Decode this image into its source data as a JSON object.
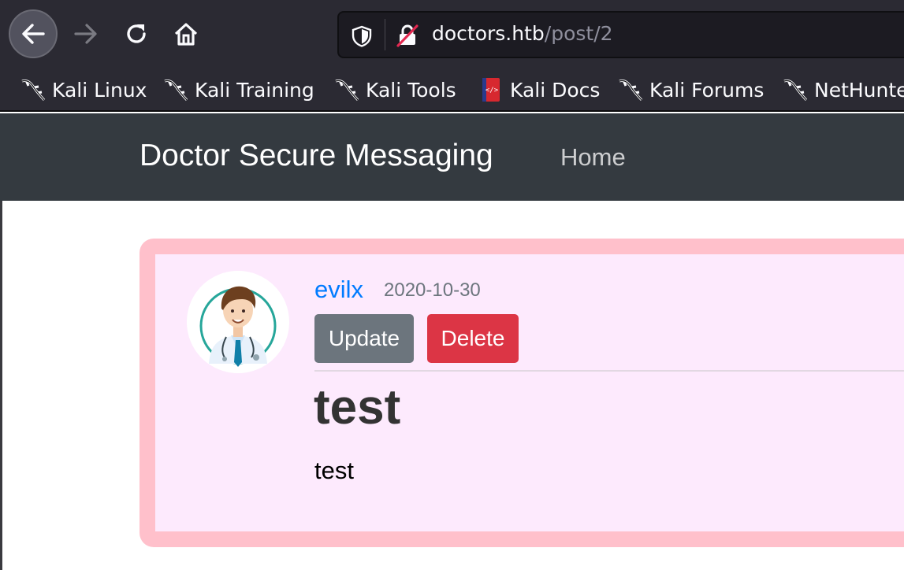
{
  "browser": {
    "url_host": "doctors.htb",
    "url_path": "/post/2",
    "bookmarks": [
      {
        "label": "Kali Linux",
        "icon": "kali-dragon-icon"
      },
      {
        "label": "Kali Training",
        "icon": "kali-dragon-icon"
      },
      {
        "label": "Kali Tools",
        "icon": "kali-dragon-icon"
      },
      {
        "label": "Kali Docs",
        "icon": "kali-docs-icon"
      },
      {
        "label": "Kali Forums",
        "icon": "kali-dragon-icon"
      },
      {
        "label": "NetHunter",
        "icon": "kali-dragon-icon"
      }
    ]
  },
  "site": {
    "brand": "Doctor Secure Messaging",
    "nav_home": "Home"
  },
  "post": {
    "author": "evilx",
    "date": "2020-10-30",
    "update_label": "Update",
    "delete_label": "Delete",
    "title": "test",
    "content": "test",
    "avatar": "doctor-avatar-icon"
  },
  "colors": {
    "card_border": "#ffc0cb",
    "card_background": "#fdeafd",
    "navbar": "#343a40",
    "link": "#007bff",
    "update_button": "#6c757d",
    "delete_button": "#dc3545"
  }
}
